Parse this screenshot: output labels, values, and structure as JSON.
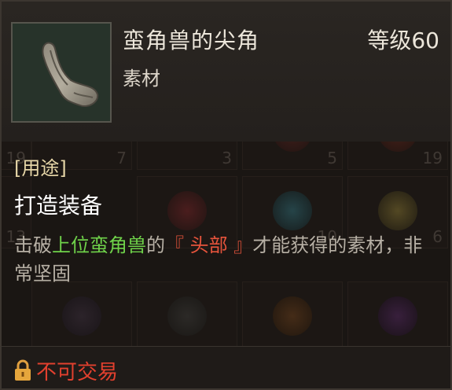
{
  "item": {
    "name": "蛮角兽的尖角",
    "level": "等级60",
    "type": "素材",
    "icon": "horn-icon"
  },
  "usage": {
    "label": "[用途]",
    "value": "打造装备"
  },
  "description": {
    "part1": "击破",
    "monster": "上位蛮角兽",
    "part2": "的",
    "bodypart": "『 头部 』",
    "part3": "才能获得的素材，非常坚固"
  },
  "footer": {
    "trade_status": "不可交易",
    "icon": "lock-icon"
  },
  "background_slots": [
    {
      "count": "19"
    },
    {
      "count": "7"
    },
    {
      "count": "3"
    },
    {
      "count": "5"
    },
    {
      "count": "19"
    },
    {
      "count": "13"
    },
    {
      "count": "10"
    },
    {
      "count": "6"
    }
  ],
  "colors": {
    "monster_highlight": "#6fd24a",
    "bodypart_highlight": "#e7543c",
    "trade_status": "#e2402e"
  }
}
